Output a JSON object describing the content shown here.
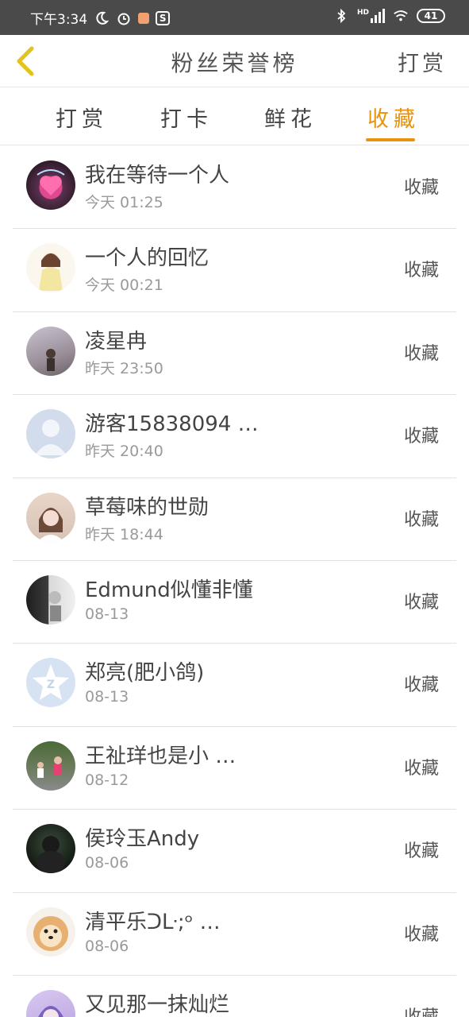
{
  "status_bar": {
    "time": "下午3:34",
    "network": "HD",
    "battery": "41"
  },
  "header": {
    "title": "粉丝荣誉榜",
    "right_link": "打赏"
  },
  "tabs": [
    {
      "label": "打赏",
      "active": false
    },
    {
      "label": "打卡",
      "active": false
    },
    {
      "label": "鲜花",
      "active": false
    },
    {
      "label": "收藏",
      "active": true
    }
  ],
  "colors": {
    "accent": "#e8930e",
    "status_bar": "#4a4a4a"
  },
  "fans": [
    {
      "name": "我在等待一个人",
      "time": "今天 01:25",
      "action": "收藏",
      "avatar": "heart-avatar"
    },
    {
      "name": "一个人的回忆",
      "time": "今天 00:21",
      "action": "收藏",
      "avatar": "anime-girl-avatar"
    },
    {
      "name": "凌星冉",
      "time": "昨天 23:50",
      "action": "收藏",
      "avatar": "photo-avatar"
    },
    {
      "name": "游客15838094 …",
      "time": "昨天 20:40",
      "action": "收藏",
      "avatar": "default-user-avatar"
    },
    {
      "name": "草莓味的世勋",
      "time": "昨天 18:44",
      "action": "收藏",
      "avatar": "photo-avatar"
    },
    {
      "name": "Edmund似懂非懂",
      "time": "08-13",
      "action": "收藏",
      "avatar": "photo-avatar"
    },
    {
      "name": "郑亮(肥小鸽)",
      "time": "08-13",
      "action": "收藏",
      "avatar": "qzone-avatar"
    },
    {
      "name": "王祉珜也是小 …",
      "time": "08-12",
      "action": "收藏",
      "avatar": "photo-avatar"
    },
    {
      "name": "侯玲玉Andy",
      "time": "08-06",
      "action": "收藏",
      "avatar": "photo-avatar"
    },
    {
      "name": "清平乐ᑐᒷ;ᵒ …",
      "time": "08-06",
      "action": "收藏",
      "avatar": "dog-avatar"
    },
    {
      "name": "又见那一抹灿烂",
      "time": "",
      "action": "收藏",
      "avatar": "anime-avatar"
    }
  ]
}
